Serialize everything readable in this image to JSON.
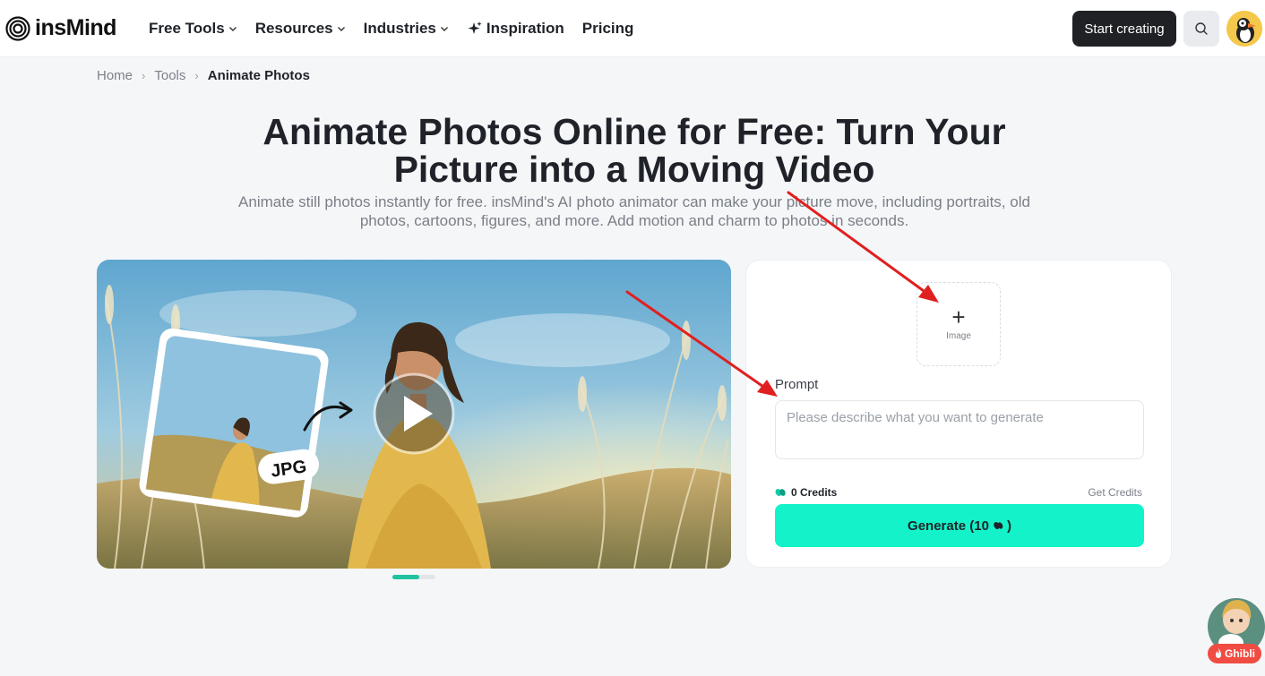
{
  "brand": {
    "name": "insMind"
  },
  "nav": {
    "items": [
      {
        "label": "Free Tools",
        "has_dropdown": true
      },
      {
        "label": "Resources",
        "has_dropdown": true
      },
      {
        "label": "Industries",
        "has_dropdown": true
      },
      {
        "label": "Inspiration",
        "icon": "sparkle-icon"
      },
      {
        "label": "Pricing"
      }
    ],
    "start_button": "Start creating",
    "search_icon": "search-icon",
    "avatar_icon": "puffin-avatar"
  },
  "breadcrumb": {
    "items": [
      "Home",
      "Tools",
      "Animate Photos"
    ]
  },
  "hero": {
    "title_line1": "Animate Photos Online for Free: Turn Your",
    "title_line2": "Picture into a Moving Video",
    "subtitle_line1": "Animate still photos instantly for free. insMind's AI photo animator can make your picture move, including portraits, old",
    "subtitle_line2": "photos, cartoons, figures, and more. Add motion and charm to photos in seconds."
  },
  "preview": {
    "badge": "JPG",
    "play_icon": "play-icon",
    "carousel": {
      "pages": 2,
      "active": 1
    }
  },
  "panel": {
    "upload_label": "Image",
    "prompt_label": "Prompt",
    "prompt_placeholder": "Please describe what you want to generate",
    "credits": "0 Credits",
    "get_credits": "Get Credits",
    "generate_label": "Generate (10",
    "generate_suffix": ")"
  },
  "floating": {
    "badge_label": "Ghibli"
  },
  "colors": {
    "accent": "#14f2c9",
    "dark_button": "#1f2125",
    "annotation_arrow": "#e02020",
    "badge_red": "#f04c42"
  }
}
